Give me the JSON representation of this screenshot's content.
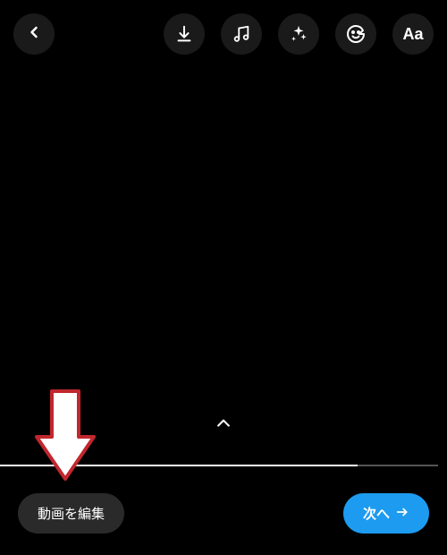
{
  "icons": {
    "back": "back-chevron",
    "download": "download",
    "music": "music-note",
    "sparkle": "sparkle-effect",
    "sticker": "sticker-smiley",
    "text": "text-tool",
    "expand": "chevron-up",
    "next_arrow": "arrow-right"
  },
  "toolbar": {
    "text_tool_glyph": "Aa"
  },
  "timeline": {
    "progress_percent": 80
  },
  "footer": {
    "edit_label": "動画を編集",
    "next_label": "次へ"
  },
  "colors": {
    "accent": "#1d9bf0",
    "button_bg": "#1a1a1a",
    "pill_bg": "#2a2a2a",
    "annotation_stroke": "#c1272d",
    "annotation_fill": "#ffffff"
  }
}
